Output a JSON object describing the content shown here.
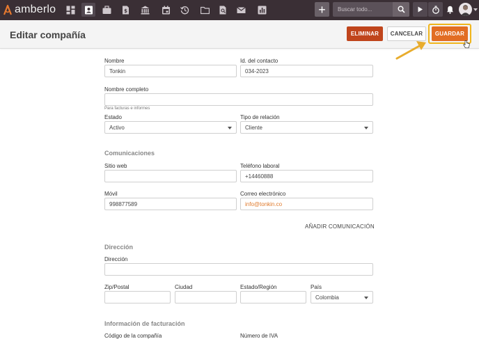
{
  "app": {
    "logo_text": "amberlo"
  },
  "topbar": {
    "nav_icons": [
      "dashboard-icon",
      "contacts-icon",
      "briefcase-icon",
      "document-dollar-icon",
      "bank-icon",
      "calendar-icon",
      "history-icon",
      "folder-icon",
      "file-search-icon",
      "mail-icon",
      "reports-icon"
    ],
    "active_icon": "contacts-icon",
    "add_label": "+",
    "search_placeholder": "Buscar todo..."
  },
  "header": {
    "title": "Editar compañía",
    "delete_label": "ELIMINAR",
    "cancel_label": "CANCELAR",
    "save_label": "GUARDAR"
  },
  "form": {
    "name_label": "Nombre",
    "name_value": "Tonkin",
    "contact_id_label": "Id. del contacto",
    "contact_id_value": "034-2023",
    "full_name_label": "Nombre completo",
    "full_name_value": "",
    "full_name_hint": "Para facturas e informes",
    "status_label": "Estado",
    "status_value": "Activo",
    "relation_label": "Tipo de relación",
    "relation_value": "Cliente",
    "comms_section": "Comunicaciones",
    "website_label": "Sitio web",
    "website_value": "",
    "work_phone_label": "Teléfono laboral",
    "work_phone_value": "+14460888",
    "mobile_label": "Móvil",
    "mobile_value": "998877589",
    "email_label": "Correo electrónico",
    "email_value": "info@tonkin.co",
    "add_comm_label": "AÑADIR COMUNICACIÓN",
    "address_section": "Dirección",
    "address_label": "Dirección",
    "address_value": "",
    "zip_label": "Zip/Postal",
    "city_label": "Ciudad",
    "state_label": "Estado/Región",
    "country_label": "País",
    "country_value": "Colombia",
    "billing_section": "Información de facturación",
    "company_code_label": "Código de la compañía",
    "vat_label": "Número de IVA"
  },
  "colors": {
    "topbar_bg": "#3a2f35",
    "accent_orange": "#e26d23",
    "delete_red": "#c0451c",
    "highlight_yellow": "#f0b51c"
  }
}
